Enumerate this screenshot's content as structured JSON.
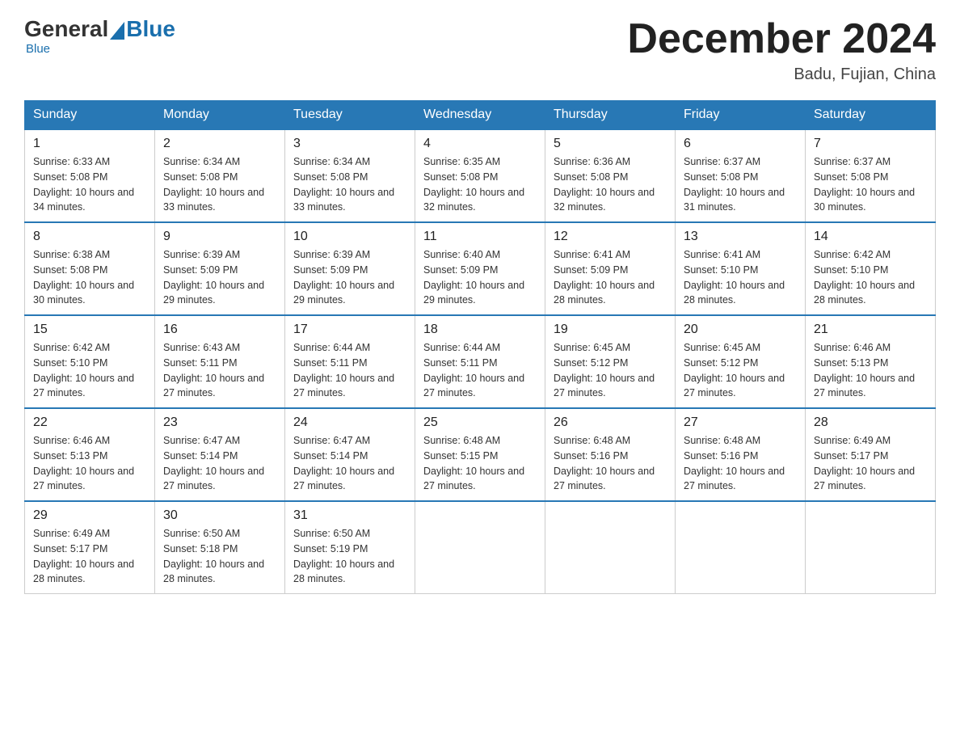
{
  "header": {
    "logo": {
      "general": "General",
      "blue": "Blue"
    },
    "title": "December 2024",
    "location": "Badu, Fujian, China"
  },
  "weekdays": [
    "Sunday",
    "Monday",
    "Tuesday",
    "Wednesday",
    "Thursday",
    "Friday",
    "Saturday"
  ],
  "weeks": [
    [
      {
        "day": "1",
        "sunrise": "6:33 AM",
        "sunset": "5:08 PM",
        "daylight": "10 hours and 34 minutes."
      },
      {
        "day": "2",
        "sunrise": "6:34 AM",
        "sunset": "5:08 PM",
        "daylight": "10 hours and 33 minutes."
      },
      {
        "day": "3",
        "sunrise": "6:34 AM",
        "sunset": "5:08 PM",
        "daylight": "10 hours and 33 minutes."
      },
      {
        "day": "4",
        "sunrise": "6:35 AM",
        "sunset": "5:08 PM",
        "daylight": "10 hours and 32 minutes."
      },
      {
        "day": "5",
        "sunrise": "6:36 AM",
        "sunset": "5:08 PM",
        "daylight": "10 hours and 32 minutes."
      },
      {
        "day": "6",
        "sunrise": "6:37 AM",
        "sunset": "5:08 PM",
        "daylight": "10 hours and 31 minutes."
      },
      {
        "day": "7",
        "sunrise": "6:37 AM",
        "sunset": "5:08 PM",
        "daylight": "10 hours and 30 minutes."
      }
    ],
    [
      {
        "day": "8",
        "sunrise": "6:38 AM",
        "sunset": "5:08 PM",
        "daylight": "10 hours and 30 minutes."
      },
      {
        "day": "9",
        "sunrise": "6:39 AM",
        "sunset": "5:09 PM",
        "daylight": "10 hours and 29 minutes."
      },
      {
        "day": "10",
        "sunrise": "6:39 AM",
        "sunset": "5:09 PM",
        "daylight": "10 hours and 29 minutes."
      },
      {
        "day": "11",
        "sunrise": "6:40 AM",
        "sunset": "5:09 PM",
        "daylight": "10 hours and 29 minutes."
      },
      {
        "day": "12",
        "sunrise": "6:41 AM",
        "sunset": "5:09 PM",
        "daylight": "10 hours and 28 minutes."
      },
      {
        "day": "13",
        "sunrise": "6:41 AM",
        "sunset": "5:10 PM",
        "daylight": "10 hours and 28 minutes."
      },
      {
        "day": "14",
        "sunrise": "6:42 AM",
        "sunset": "5:10 PM",
        "daylight": "10 hours and 28 minutes."
      }
    ],
    [
      {
        "day": "15",
        "sunrise": "6:42 AM",
        "sunset": "5:10 PM",
        "daylight": "10 hours and 27 minutes."
      },
      {
        "day": "16",
        "sunrise": "6:43 AM",
        "sunset": "5:11 PM",
        "daylight": "10 hours and 27 minutes."
      },
      {
        "day": "17",
        "sunrise": "6:44 AM",
        "sunset": "5:11 PM",
        "daylight": "10 hours and 27 minutes."
      },
      {
        "day": "18",
        "sunrise": "6:44 AM",
        "sunset": "5:11 PM",
        "daylight": "10 hours and 27 minutes."
      },
      {
        "day": "19",
        "sunrise": "6:45 AM",
        "sunset": "5:12 PM",
        "daylight": "10 hours and 27 minutes."
      },
      {
        "day": "20",
        "sunrise": "6:45 AM",
        "sunset": "5:12 PM",
        "daylight": "10 hours and 27 minutes."
      },
      {
        "day": "21",
        "sunrise": "6:46 AM",
        "sunset": "5:13 PM",
        "daylight": "10 hours and 27 minutes."
      }
    ],
    [
      {
        "day": "22",
        "sunrise": "6:46 AM",
        "sunset": "5:13 PM",
        "daylight": "10 hours and 27 minutes."
      },
      {
        "day": "23",
        "sunrise": "6:47 AM",
        "sunset": "5:14 PM",
        "daylight": "10 hours and 27 minutes."
      },
      {
        "day": "24",
        "sunrise": "6:47 AM",
        "sunset": "5:14 PM",
        "daylight": "10 hours and 27 minutes."
      },
      {
        "day": "25",
        "sunrise": "6:48 AM",
        "sunset": "5:15 PM",
        "daylight": "10 hours and 27 minutes."
      },
      {
        "day": "26",
        "sunrise": "6:48 AM",
        "sunset": "5:16 PM",
        "daylight": "10 hours and 27 minutes."
      },
      {
        "day": "27",
        "sunrise": "6:48 AM",
        "sunset": "5:16 PM",
        "daylight": "10 hours and 27 minutes."
      },
      {
        "day": "28",
        "sunrise": "6:49 AM",
        "sunset": "5:17 PM",
        "daylight": "10 hours and 27 minutes."
      }
    ],
    [
      {
        "day": "29",
        "sunrise": "6:49 AM",
        "sunset": "5:17 PM",
        "daylight": "10 hours and 28 minutes."
      },
      {
        "day": "30",
        "sunrise": "6:50 AM",
        "sunset": "5:18 PM",
        "daylight": "10 hours and 28 minutes."
      },
      {
        "day": "31",
        "sunrise": "6:50 AM",
        "sunset": "5:19 PM",
        "daylight": "10 hours and 28 minutes."
      },
      null,
      null,
      null,
      null
    ]
  ]
}
